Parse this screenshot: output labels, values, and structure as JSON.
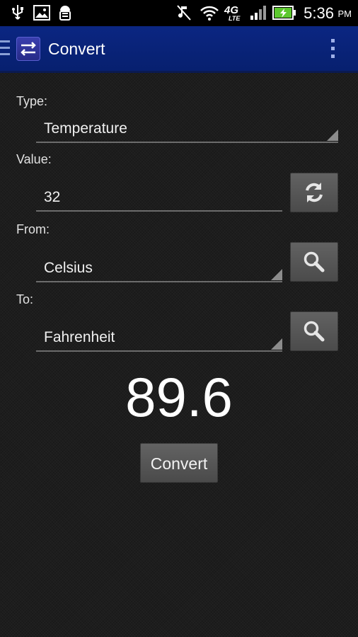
{
  "status_bar": {
    "time": "5:36",
    "ampm": "PM",
    "icons": [
      "usb-icon",
      "image-icon",
      "android-debug-icon",
      "mute-icon",
      "wifi-icon",
      "4g-lte-icon",
      "signal-icon",
      "battery-charging-icon"
    ],
    "network_label": "4G",
    "network_sub": "LTE"
  },
  "action_bar": {
    "title": "Convert",
    "background_color": "#0b2682"
  },
  "form": {
    "type_label": "Type:",
    "type_value": "Temperature",
    "value_label": "Value:",
    "value_input": "32",
    "from_label": "From:",
    "from_value": "Celsius",
    "to_label": "To:",
    "to_value": "Fahrenheit"
  },
  "result": "89.6",
  "convert_button": "Convert"
}
